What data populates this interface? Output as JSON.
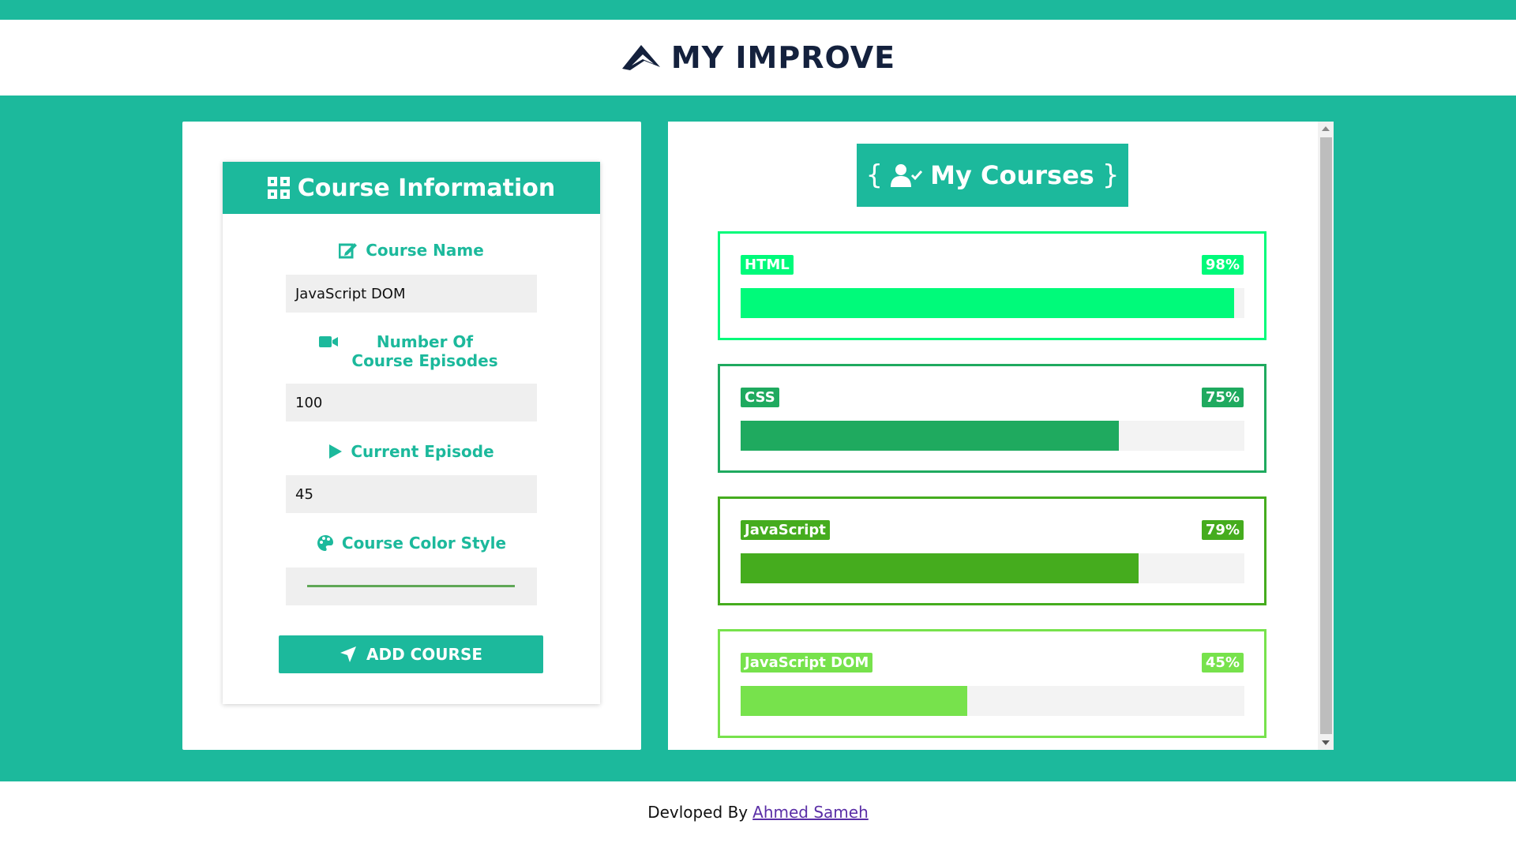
{
  "header": {
    "logo_text": "MY IMPROVE"
  },
  "form": {
    "title": "Course Information",
    "course_name": {
      "label": "Course Name",
      "value": "JavaScript DOM"
    },
    "episodes": {
      "label": "Number Of Course Episodes",
      "value": "100"
    },
    "current_episode": {
      "label": "Current Episode",
      "value": "45"
    },
    "color_style": {
      "label": "Course Color Style",
      "value": "#5fa756"
    },
    "add_button": "ADD COURSE"
  },
  "courses": {
    "title": "My Courses",
    "brace_open": "{",
    "brace_close": "}",
    "items": [
      {
        "name": "HTML",
        "percent_label": "98%",
        "percent": 98,
        "color": "#00fa7a"
      },
      {
        "name": "CSS",
        "percent_label": "75%",
        "percent": 75,
        "color": "#1faa5f"
      },
      {
        "name": "JavaScript",
        "percent_label": "79%",
        "percent": 79,
        "color": "#45ac1e"
      },
      {
        "name": "JavaScript DOM",
        "percent_label": "45%",
        "percent": 45,
        "color": "#77e24c"
      }
    ]
  },
  "footer": {
    "text": "Devloped By",
    "author": "Ahmed Sameh"
  },
  "colors": {
    "accent": "#1cb99c",
    "logo": "#14213d"
  }
}
